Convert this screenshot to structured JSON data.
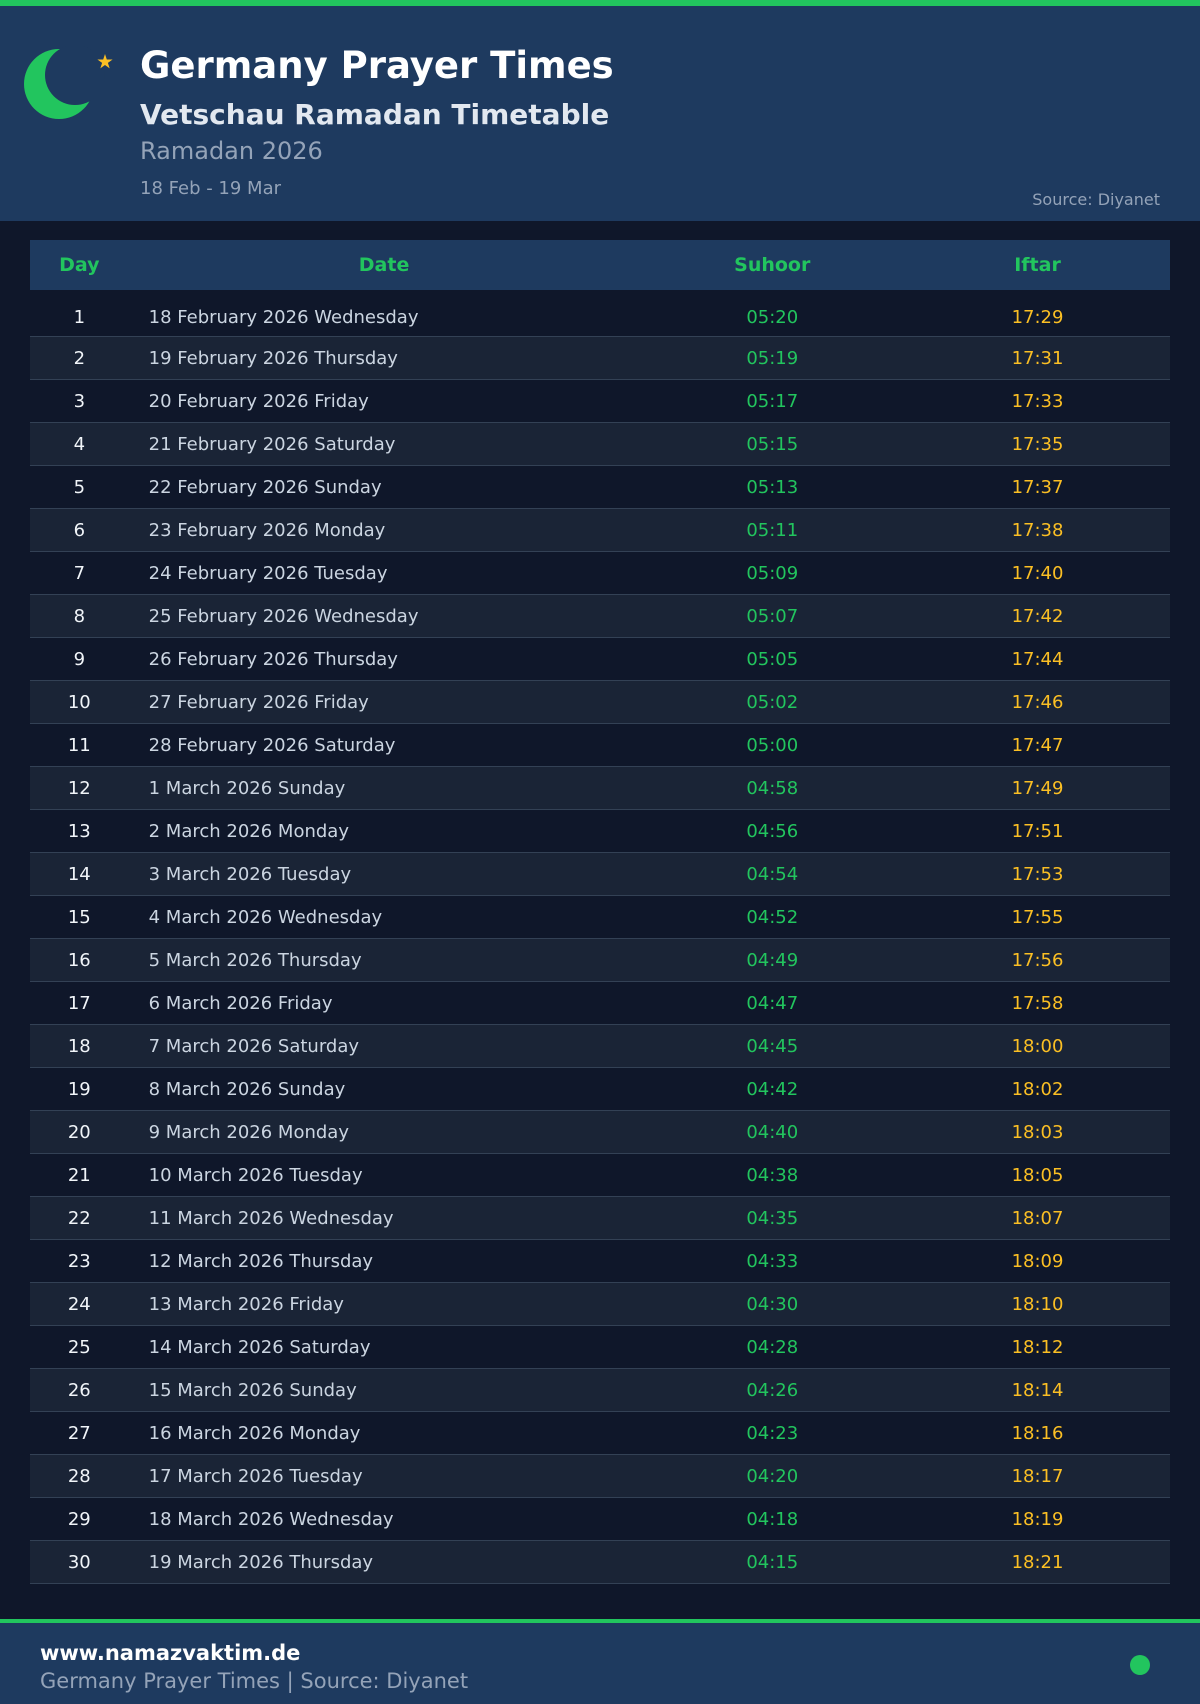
{
  "header": {
    "title": "Germany Prayer Times",
    "subtitle": "Vetschau Ramadan Timetable",
    "period": "Ramadan 2026",
    "range": "18 Feb - 19 Mar",
    "source": "Source: Diyanet"
  },
  "colors": {
    "accent": "#22c55e",
    "iftar": "#fbbf24",
    "header_bg": "#1e3a5f",
    "page_bg": "#0f172a"
  },
  "icons": {
    "logo": "crescent-moon-icon",
    "star": "star-icon"
  },
  "table": {
    "headers": {
      "day": "Day",
      "date": "Date",
      "suhoor": "Suhoor",
      "iftar": "Iftar"
    },
    "rows": [
      {
        "day": "1",
        "date": "18 February 2026 Wednesday",
        "suhoor": "05:20",
        "iftar": "17:29"
      },
      {
        "day": "2",
        "date": "19 February 2026 Thursday",
        "suhoor": "05:19",
        "iftar": "17:31"
      },
      {
        "day": "3",
        "date": "20 February 2026 Friday",
        "suhoor": "05:17",
        "iftar": "17:33"
      },
      {
        "day": "4",
        "date": "21 February 2026 Saturday",
        "suhoor": "05:15",
        "iftar": "17:35"
      },
      {
        "day": "5",
        "date": "22 February 2026 Sunday",
        "suhoor": "05:13",
        "iftar": "17:37"
      },
      {
        "day": "6",
        "date": "23 February 2026 Monday",
        "suhoor": "05:11",
        "iftar": "17:38"
      },
      {
        "day": "7",
        "date": "24 February 2026 Tuesday",
        "suhoor": "05:09",
        "iftar": "17:40"
      },
      {
        "day": "8",
        "date": "25 February 2026 Wednesday",
        "suhoor": "05:07",
        "iftar": "17:42"
      },
      {
        "day": "9",
        "date": "26 February 2026 Thursday",
        "suhoor": "05:05",
        "iftar": "17:44"
      },
      {
        "day": "10",
        "date": "27 February 2026 Friday",
        "suhoor": "05:02",
        "iftar": "17:46"
      },
      {
        "day": "11",
        "date": "28 February 2026 Saturday",
        "suhoor": "05:00",
        "iftar": "17:47"
      },
      {
        "day": "12",
        "date": "1 March 2026 Sunday",
        "suhoor": "04:58",
        "iftar": "17:49"
      },
      {
        "day": "13",
        "date": "2 March 2026 Monday",
        "suhoor": "04:56",
        "iftar": "17:51"
      },
      {
        "day": "14",
        "date": "3 March 2026 Tuesday",
        "suhoor": "04:54",
        "iftar": "17:53"
      },
      {
        "day": "15",
        "date": "4 March 2026 Wednesday",
        "suhoor": "04:52",
        "iftar": "17:55"
      },
      {
        "day": "16",
        "date": "5 March 2026 Thursday",
        "suhoor": "04:49",
        "iftar": "17:56"
      },
      {
        "day": "17",
        "date": "6 March 2026 Friday",
        "suhoor": "04:47",
        "iftar": "17:58"
      },
      {
        "day": "18",
        "date": "7 March 2026 Saturday",
        "suhoor": "04:45",
        "iftar": "18:00"
      },
      {
        "day": "19",
        "date": "8 March 2026 Sunday",
        "suhoor": "04:42",
        "iftar": "18:02"
      },
      {
        "day": "20",
        "date": "9 March 2026 Monday",
        "suhoor": "04:40",
        "iftar": "18:03"
      },
      {
        "day": "21",
        "date": "10 March 2026 Tuesday",
        "suhoor": "04:38",
        "iftar": "18:05"
      },
      {
        "day": "22",
        "date": "11 March 2026 Wednesday",
        "suhoor": "04:35",
        "iftar": "18:07"
      },
      {
        "day": "23",
        "date": "12 March 2026 Thursday",
        "suhoor": "04:33",
        "iftar": "18:09"
      },
      {
        "day": "24",
        "date": "13 March 2026 Friday",
        "suhoor": "04:30",
        "iftar": "18:10"
      },
      {
        "day": "25",
        "date": "14 March 2026 Saturday",
        "suhoor": "04:28",
        "iftar": "18:12"
      },
      {
        "day": "26",
        "date": "15 March 2026 Sunday",
        "suhoor": "04:26",
        "iftar": "18:14"
      },
      {
        "day": "27",
        "date": "16 March 2026 Monday",
        "suhoor": "04:23",
        "iftar": "18:16"
      },
      {
        "day": "28",
        "date": "17 March 2026 Tuesday",
        "suhoor": "04:20",
        "iftar": "18:17"
      },
      {
        "day": "29",
        "date": "18 March 2026 Wednesday",
        "suhoor": "04:18",
        "iftar": "18:19"
      },
      {
        "day": "30",
        "date": "19 March 2026 Thursday",
        "suhoor": "04:15",
        "iftar": "18:21"
      }
    ]
  },
  "footer": {
    "site": "www.namazvaktim.de",
    "note": "Germany Prayer Times | Source: Diyanet"
  }
}
